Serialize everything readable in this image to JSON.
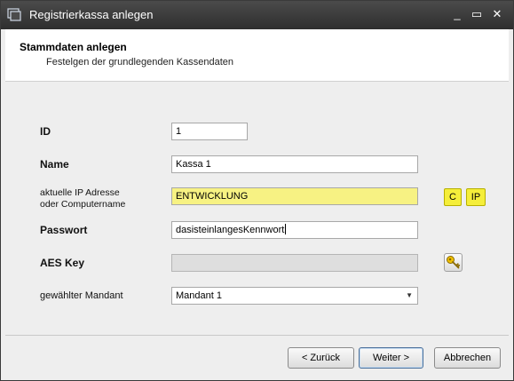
{
  "window": {
    "title": "Registrierkassa anlegen",
    "controls": {
      "minimize": "_",
      "maximize": "▭",
      "close": "✕"
    }
  },
  "header": {
    "title": "Stammdaten anlegen",
    "subtitle": "Festelgen der grundlegenden Kassendaten"
  },
  "form": {
    "id": {
      "label": "ID",
      "value": "1"
    },
    "name": {
      "label": "Name",
      "value": "Kassa 1"
    },
    "ip": {
      "label_line1": "aktuelle IP Adresse",
      "label_line2": "oder Computername",
      "value": "ENTWICKLUNG",
      "btn_c": "C",
      "btn_ip": "IP"
    },
    "password": {
      "label": "Passwort",
      "value": "dasisteinlangesKennwort"
    },
    "aes": {
      "label": "AES Key",
      "value": "",
      "key_icon": "key-icon"
    },
    "mandant": {
      "label": "gewählter Mandant",
      "value": "Mandant 1"
    }
  },
  "footer": {
    "back": "< Zurück",
    "next": "Weiter >",
    "cancel": "Abbrechen"
  },
  "colors": {
    "titlebar": "#3a3a3a",
    "highlight_field": "#f7f283",
    "yellow_button": "#f5ee3a"
  }
}
